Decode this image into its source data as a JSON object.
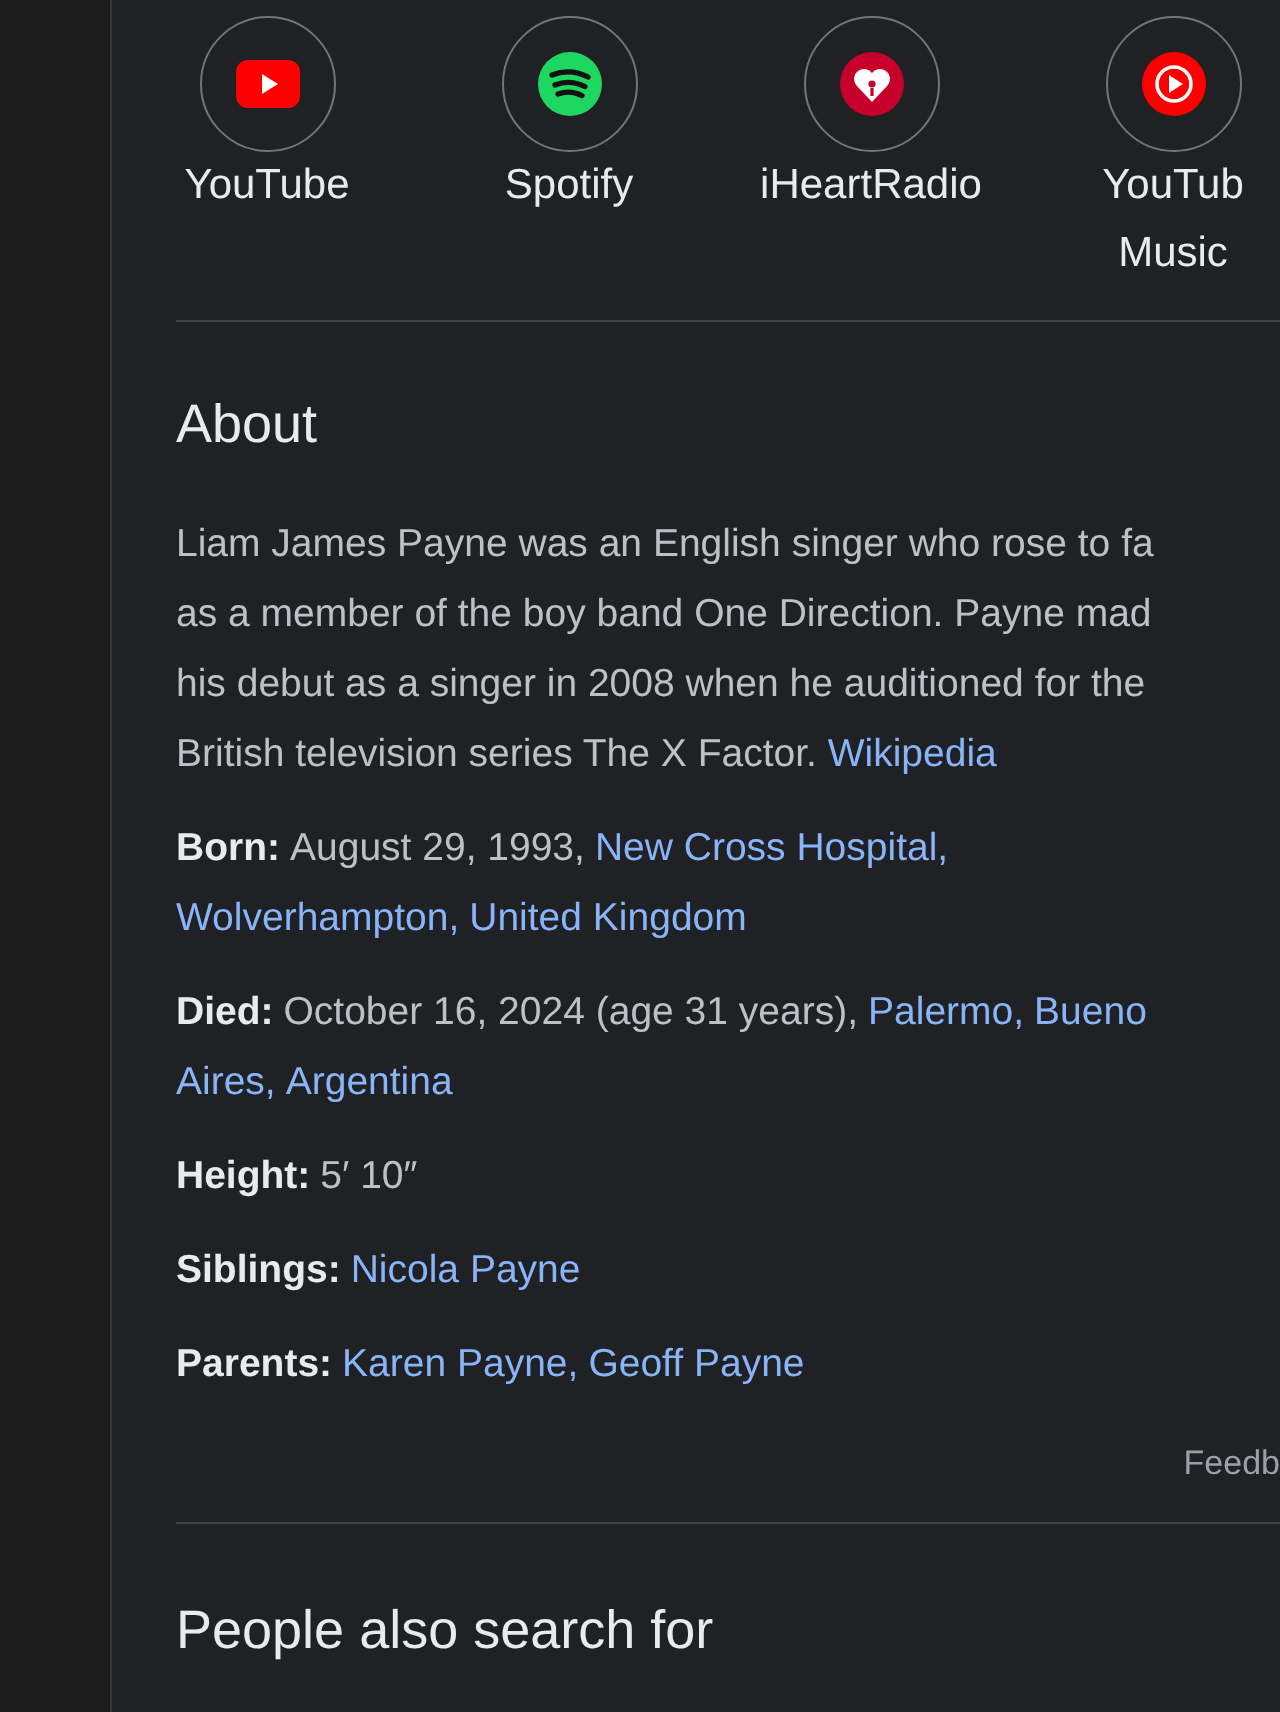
{
  "apps": [
    {
      "kind": "youtube",
      "label_lines": [
        "YouTube"
      ]
    },
    {
      "kind": "spotify",
      "label_lines": [
        "Spotify"
      ]
    },
    {
      "kind": "iheartradio",
      "label_lines": [
        "iHeartRadio"
      ]
    },
    {
      "kind": "youtube_music",
      "label_lines": [
        "YouTub",
        "Music"
      ]
    }
  ],
  "about": {
    "heading": "About",
    "description_lines": [
      "Liam James Payne was an English singer who rose to fa",
      "as a member of the boy band One Direction. Payne mad",
      "his debut as a singer in 2008 when he auditioned for the",
      "British television series The X Factor."
    ],
    "source_link": "Wikipedia"
  },
  "facts": [
    {
      "label": "Born:",
      "lines": [
        [
          {
            "text": "August 29, 1993,",
            "link": false
          },
          {
            "text": "New Cross Hospital,",
            "link": true
          }
        ],
        [
          {
            "text": "Wolverhampton,",
            "link": true
          },
          {
            "text": "United Kingdom",
            "link": true
          }
        ]
      ]
    },
    {
      "label": "Died:",
      "lines": [
        [
          {
            "text": "October 16, 2024 (age 31 years),",
            "link": false
          },
          {
            "text": "Palermo,",
            "link": true
          },
          {
            "text": "Bueno",
            "link": true
          }
        ],
        [
          {
            "text": "Aires,",
            "link": true
          },
          {
            "text": "Argentina",
            "link": true
          }
        ]
      ]
    },
    {
      "label": "Height:",
      "lines": [
        [
          {
            "text": "5′ 10″",
            "link": false
          }
        ]
      ]
    },
    {
      "label": "Siblings:",
      "lines": [
        [
          {
            "text": "Nicola Payne",
            "link": true
          }
        ]
      ]
    },
    {
      "label": "Parents:",
      "lines": [
        [
          {
            "text": "Karen Payne,",
            "link": true
          },
          {
            "text": "Geoff Payne",
            "link": true
          }
        ]
      ]
    }
  ],
  "feedback": "Feedb",
  "related_heading": "People also search for"
}
